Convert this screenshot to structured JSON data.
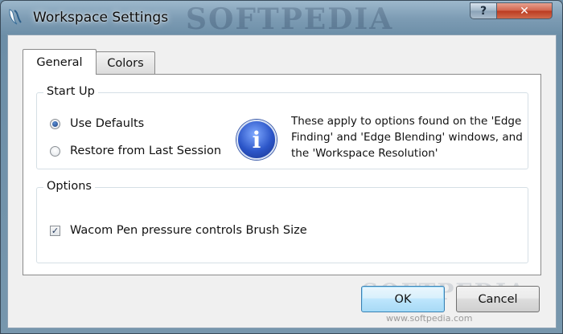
{
  "window": {
    "title": "Workspace Settings",
    "watermark": "SOFTPEDIA",
    "help_button": "?",
    "close_button": "✕"
  },
  "tabs": [
    {
      "label": "General",
      "selected": true
    },
    {
      "label": "Colors",
      "selected": false
    }
  ],
  "startup": {
    "title": "Start Up",
    "options": [
      {
        "label": "Use Defaults",
        "checked": true
      },
      {
        "label": "Restore from Last Session",
        "checked": false
      }
    ],
    "info_icon": "info-icon",
    "info_text": "These apply to options found on the 'Edge Finding' and 'Edge Blending' windows, and the 'Workspace Resolution'"
  },
  "options": {
    "title": "Options",
    "checkbox_label": "Wacom Pen pressure controls Brush Size",
    "checkbox_checked": true
  },
  "buttons": {
    "ok": "OK",
    "cancel": "Cancel"
  },
  "footer": {
    "watermark": "SOFTPEDIA",
    "url": "www.softpedia.com"
  },
  "colors": {
    "selection_blue": "#3c7fb1",
    "radio_dot": "#1c3f7a"
  }
}
